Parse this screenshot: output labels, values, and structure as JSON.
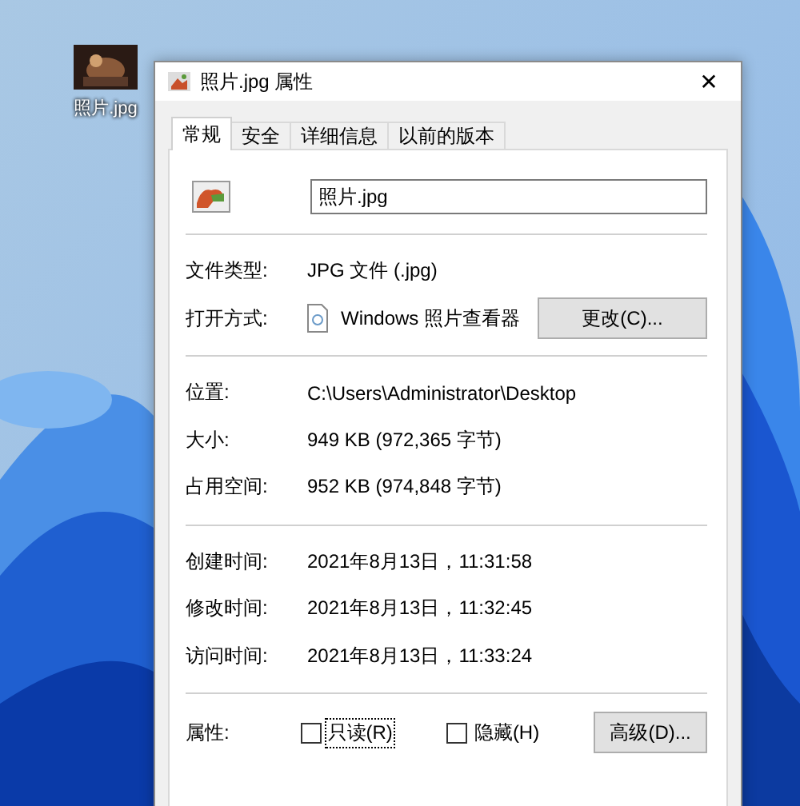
{
  "desktop": {
    "icons": [
      {
        "label": "照片.jpg"
      }
    ]
  },
  "window": {
    "title": "照片.jpg 属性",
    "close": "✕",
    "tabs": [
      {
        "label": "常规",
        "selected": true
      },
      {
        "label": "安全",
        "selected": false
      },
      {
        "label": "详细信息",
        "selected": false
      },
      {
        "label": "以前的版本",
        "selected": false
      }
    ],
    "filename": "照片.jpg",
    "sections": [
      [
        {
          "kind": "text",
          "label": "文件类型:",
          "value": "JPG 文件 (.jpg)"
        },
        {
          "kind": "app",
          "label": "打开方式:",
          "value": "Windows 照片查看器",
          "button": "更改(C)..."
        }
      ],
      [
        {
          "kind": "text",
          "label": "位置:",
          "value": "C:\\Users\\Administrator\\Desktop"
        },
        {
          "kind": "text",
          "label": "大小:",
          "value": "949 KB (972,365 字节)"
        },
        {
          "kind": "text",
          "label": "占用空间:",
          "value": "952 KB (974,848 字节)"
        }
      ],
      [
        {
          "kind": "text",
          "label": "创建时间:",
          "value": "2021年8月13日，11:31:58"
        },
        {
          "kind": "text",
          "label": "修改时间:",
          "value": "2021年8月13日，11:32:45"
        },
        {
          "kind": "text",
          "label": "访问时间:",
          "value": "2021年8月13日，11:33:24"
        }
      ]
    ],
    "attributes": {
      "label": "属性:",
      "checkboxes": [
        {
          "label": "只读(R)",
          "checked": false,
          "focused": true
        },
        {
          "label": "隐藏(H)",
          "checked": false,
          "focused": false
        }
      ],
      "button": "高级(D)..."
    }
  }
}
